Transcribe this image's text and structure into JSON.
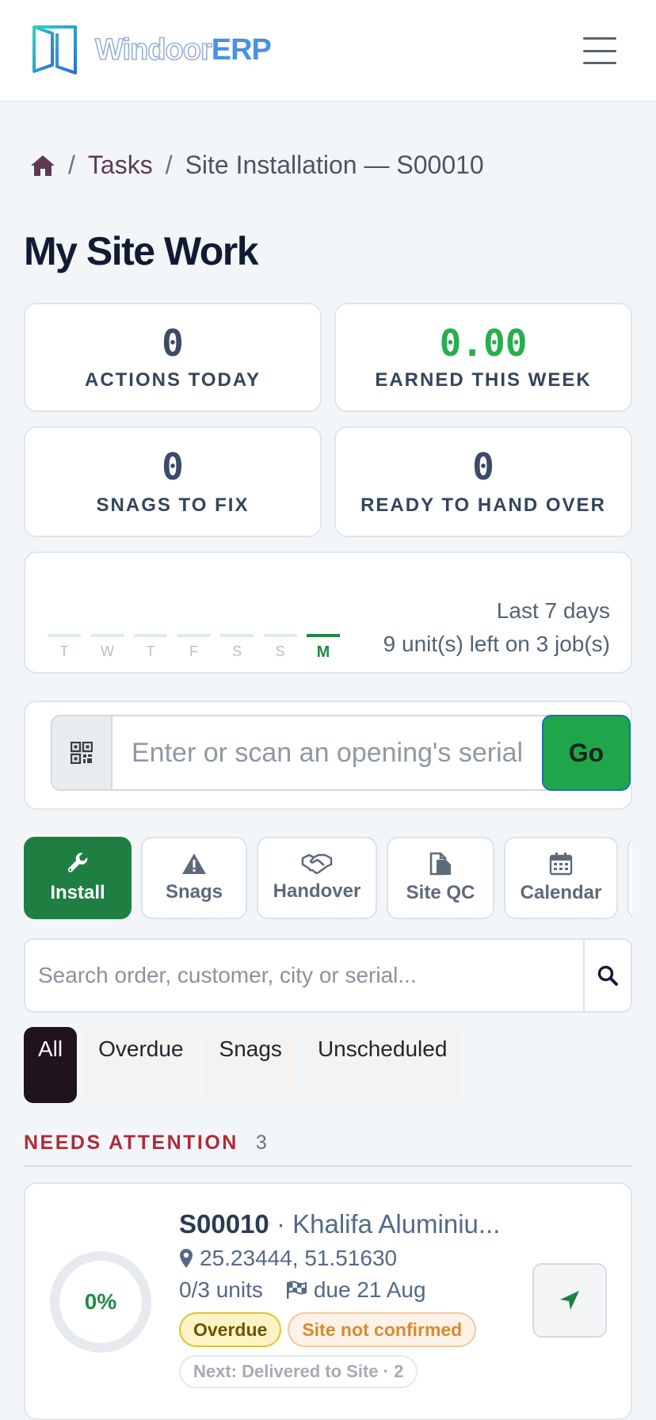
{
  "header": {
    "logo_word": "Windoor",
    "logo_accent": "ERP"
  },
  "breadcrumb": {
    "tasks": "Tasks",
    "separator": "/",
    "current": "Site Installation — S00010"
  },
  "page_title": "My Site Work",
  "stats": {
    "actions_today": {
      "value": "0",
      "label": "ACTIONS TODAY"
    },
    "earned_week": {
      "value": "0.00",
      "label": "EARNED THIS WEEK"
    },
    "snags_to_fix": {
      "value": "0",
      "label": "SNAGS TO FIX"
    },
    "ready_handover": {
      "value": "0",
      "label": "READY TO HAND OVER"
    }
  },
  "week": {
    "days": [
      "T",
      "W",
      "T",
      "F",
      "S",
      "S",
      "M"
    ],
    "active_day_index": 6,
    "range_label": "Last 7 days",
    "summary": "9 unit(s) left on 3 job(s)"
  },
  "scan": {
    "placeholder": "Enter or scan an opening's serial",
    "go_label": "Go"
  },
  "tabs": [
    {
      "label": "Install",
      "icon": "wrench-icon",
      "active": true
    },
    {
      "label": "Snags",
      "icon": "warning-icon",
      "active": false
    },
    {
      "label": "Handover",
      "icon": "handshake-icon",
      "active": false
    },
    {
      "label": "Site QC",
      "icon": "clipboard-icon",
      "active": false
    },
    {
      "label": "Calendar",
      "icon": "calendar-icon",
      "active": false
    }
  ],
  "search": {
    "placeholder": "Search order, customer, city or serial..."
  },
  "filters": [
    "All",
    "Overdue",
    "Snags",
    "Unscheduled"
  ],
  "section": {
    "title": "NEEDS ATTENTION",
    "count": "3"
  },
  "job": {
    "progress_label": "0%",
    "progress_value": 0,
    "order": "S00010",
    "separator": " · ",
    "customer": "Khalifa Aluminiu...",
    "coords": "25.23444, 51.51630",
    "units": "0/3 units",
    "due": "due 21 Aug",
    "badge_overdue": "Overdue",
    "badge_site": "Site not confirmed",
    "next_step": "Next: Delivered to Site · 2"
  },
  "colors": {
    "primary_green": "#1f7f43",
    "accent_blue": "#4a90e2",
    "danger": "#b02a37"
  }
}
